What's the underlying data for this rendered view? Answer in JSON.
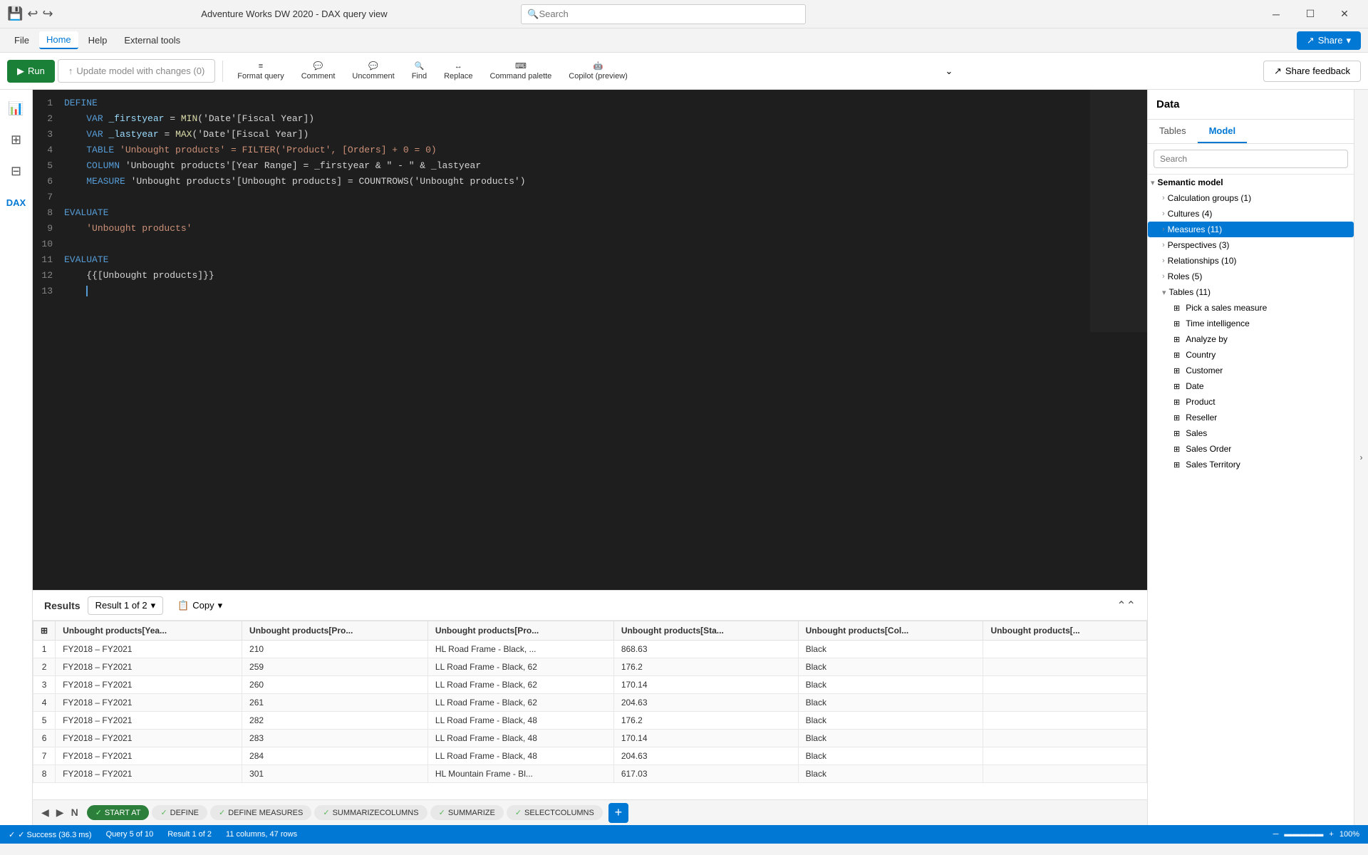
{
  "title_bar": {
    "save_icon": "💾",
    "undo_icon": "↩",
    "redo_icon": "↪",
    "window_title": "Adventure Works DW 2020 - DAX query view",
    "search_placeholder": "Search",
    "minimize": "─",
    "restore": "☐",
    "close": "✕"
  },
  "menu": {
    "items": [
      "File",
      "Home",
      "Help",
      "External tools"
    ],
    "active": "Home",
    "share_label": "Share"
  },
  "ribbon": {
    "format_query": "Format query",
    "comment": "Comment",
    "uncomment": "Uncomment",
    "find": "Find",
    "replace": "Replace",
    "command_palette": "Command palette",
    "copilot": "Copilot (preview)",
    "run_label": "Run",
    "update_label": "Update model with changes (0)",
    "share_feedback": "Share feedback",
    "more": "⌄"
  },
  "code_lines": [
    {
      "num": 1,
      "content": "DEFINE",
      "type": "kw"
    },
    {
      "num": 2,
      "content": "    VAR _firstyear = MIN('Date'[Fiscal Year])",
      "type": "var"
    },
    {
      "num": 3,
      "content": "    VAR _lastyear = MAX('Date'[Fiscal Year])",
      "type": "var"
    },
    {
      "num": 4,
      "content": "    TABLE 'Unbought products' = FILTER('Product', [Orders] + 0 = 0)",
      "type": "table"
    },
    {
      "num": 5,
      "content": "    COLUMN 'Unbought products'[Year Range] = _firstyear & \" - \" & _lastyear",
      "type": "column"
    },
    {
      "num": 6,
      "content": "    MEASURE 'Unbought products'[Unbought products] = COUNTROWS('Unbought products')",
      "type": "measure"
    },
    {
      "num": 7,
      "content": "",
      "type": "empty"
    },
    {
      "num": 8,
      "content": "EVALUATE",
      "type": "kw"
    },
    {
      "num": 9,
      "content": "    'Unbought products'",
      "type": "str"
    },
    {
      "num": 10,
      "content": "",
      "type": "empty"
    },
    {
      "num": 11,
      "content": "EVALUATE",
      "type": "kw"
    },
    {
      "num": 12,
      "content": "    {{[Unbought products]}}",
      "type": "expr"
    },
    {
      "num": 13,
      "content": "    ",
      "type": "cursor"
    }
  ],
  "results": {
    "title": "Results",
    "result_selector": "Result 1 of 2",
    "copy_label": "Copy",
    "columns": [
      "Unbought products[Yea...",
      "Unbought products[Pro...",
      "Unbought products[Pro...",
      "Unbought products[Sta...",
      "Unbought products[Col...",
      "Unbought products[..."
    ],
    "rows": [
      [
        1,
        "FY2018 – FY2021",
        "210",
        "HL Road Frame - Black, ...",
        "868.63",
        "Black",
        ""
      ],
      [
        2,
        "FY2018 – FY2021",
        "259",
        "LL Road Frame - Black, 62",
        "176.2",
        "Black",
        ""
      ],
      [
        3,
        "FY2018 – FY2021",
        "260",
        "LL Road Frame - Black, 62",
        "170.14",
        "Black",
        ""
      ],
      [
        4,
        "FY2018 – FY2021",
        "261",
        "LL Road Frame - Black, 62",
        "204.63",
        "Black",
        ""
      ],
      [
        5,
        "FY2018 – FY2021",
        "282",
        "LL Road Frame - Black, 48",
        "176.2",
        "Black",
        ""
      ],
      [
        6,
        "FY2018 – FY2021",
        "283",
        "LL Road Frame - Black, 48",
        "170.14",
        "Black",
        ""
      ],
      [
        7,
        "FY2018 – FY2021",
        "284",
        "LL Road Frame - Black, 48",
        "204.63",
        "Black",
        ""
      ],
      [
        8,
        "FY2018 – FY2021",
        "301",
        "HL Mountain Frame - Bl...",
        "617.03",
        "Black",
        ""
      ]
    ],
    "tabs": [
      {
        "label": "N",
        "type": "nav"
      },
      {
        "label": "START AT",
        "active": true,
        "checked": true
      },
      {
        "label": "DEFINE",
        "active": false,
        "checked": true
      },
      {
        "label": "DEFINE MEASURES",
        "active": false,
        "checked": true
      },
      {
        "label": "SUMMARIZECOLUMNS",
        "active": false,
        "checked": true
      },
      {
        "label": "SUMMARIZE",
        "active": false,
        "checked": true
      },
      {
        "label": "SELECTCOLUMNS",
        "active": false,
        "checked": true
      }
    ],
    "add_tab": "+"
  },
  "status_bar": {
    "success": "✓ Success (36.3 ms)",
    "query": "Query 5 of 10",
    "result": "Result 1 of 2",
    "columns": "11 columns, 47 rows",
    "zoom": "100%"
  },
  "right_panel": {
    "title": "Data",
    "tabs": [
      "Tables",
      "Model"
    ],
    "active_tab": "Model",
    "search_placeholder": "Search",
    "expand_icon": ">",
    "tree": [
      {
        "label": "Semantic model",
        "level": 0,
        "expanded": true,
        "type": "root"
      },
      {
        "label": "Calculation groups (1)",
        "level": 1,
        "expanded": false,
        "type": "folder"
      },
      {
        "label": "Cultures (4)",
        "level": 1,
        "expanded": false,
        "type": "folder"
      },
      {
        "label": "Measures (11)",
        "level": 1,
        "expanded": false,
        "type": "folder",
        "active": true
      },
      {
        "label": "Perspectives (3)",
        "level": 1,
        "expanded": false,
        "type": "folder"
      },
      {
        "label": "Relationships (10)",
        "level": 1,
        "expanded": false,
        "type": "folder"
      },
      {
        "label": "Roles (5)",
        "level": 1,
        "expanded": false,
        "type": "folder"
      },
      {
        "label": "Tables (11)",
        "level": 1,
        "expanded": true,
        "type": "folder"
      },
      {
        "label": "Pick a sales measure",
        "level": 2,
        "expanded": false,
        "type": "table"
      },
      {
        "label": "Time intelligence",
        "level": 2,
        "expanded": false,
        "type": "table"
      },
      {
        "label": "Analyze by",
        "level": 2,
        "expanded": false,
        "type": "table"
      },
      {
        "label": "Country",
        "level": 2,
        "expanded": false,
        "type": "table"
      },
      {
        "label": "Customer",
        "level": 2,
        "expanded": false,
        "type": "table"
      },
      {
        "label": "Date",
        "level": 2,
        "expanded": false,
        "type": "table"
      },
      {
        "label": "Product",
        "level": 2,
        "expanded": false,
        "type": "table"
      },
      {
        "label": "Reseller",
        "level": 2,
        "expanded": false,
        "type": "table"
      },
      {
        "label": "Sales",
        "level": 2,
        "expanded": false,
        "type": "table"
      },
      {
        "label": "Sales Order",
        "level": 2,
        "expanded": false,
        "type": "table"
      },
      {
        "label": "Sales Territory",
        "level": 2,
        "expanded": false,
        "type": "table"
      }
    ]
  },
  "left_sidebar": {
    "icons": [
      {
        "name": "bar-chart-icon",
        "symbol": "📊"
      },
      {
        "name": "table-icon",
        "symbol": "⊞"
      },
      {
        "name": "model-icon",
        "symbol": "⊟"
      },
      {
        "name": "dax-icon",
        "symbol": "◇"
      }
    ]
  }
}
